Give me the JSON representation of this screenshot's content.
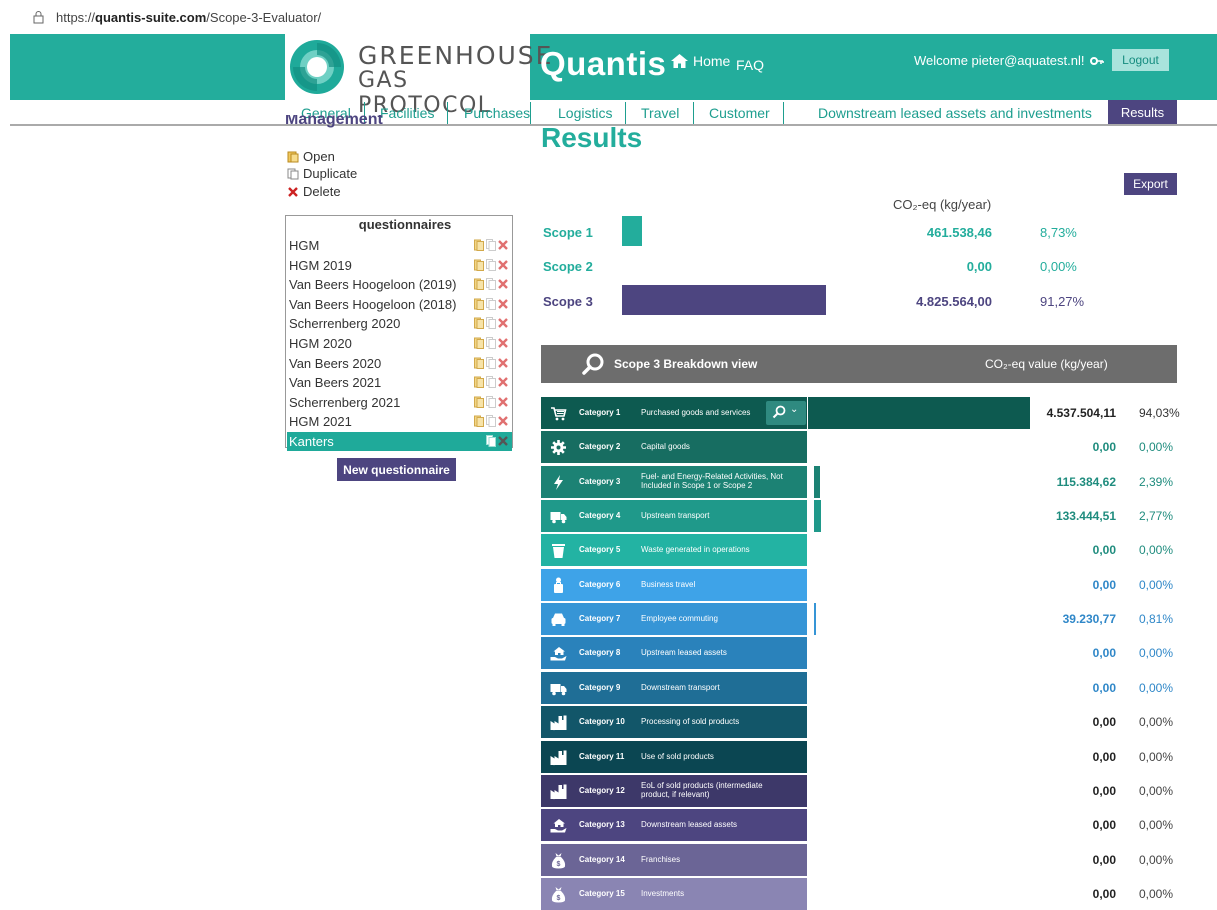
{
  "browser": {
    "url_prefix": "https://",
    "url_domain": "quantis-suite.com",
    "url_path": "/Scope-3-Evaluator/"
  },
  "header": {
    "logo_line1": "GREENHOUSE",
    "logo_line2": "GAS PROTOCOL",
    "brand": "Quantis",
    "home": "Home",
    "faq": "FAQ",
    "welcome": "Welcome pieter@aquatest.nl!",
    "logout": "Logout",
    "color": "#23ad9c"
  },
  "tabs": [
    "General",
    "Facilities",
    "Purchases",
    "Logistics",
    "Travel",
    "Customer",
    "Downstream leased assets and investments"
  ],
  "active_tab": "Results",
  "management": {
    "title": "Management",
    "open": "Open",
    "duplicate": "Duplicate",
    "delete": "Delete",
    "list_title": "questionnaires",
    "items": [
      "HGM",
      "HGM 2019",
      "Van Beers Hoogeloon (2019)",
      "Van Beers Hoogeloon (2018)",
      "Scherrenberg 2020",
      "HGM 2020",
      "Van Beers 2020",
      "Van Beers 2021",
      "Scherrenberg 2021",
      "HGM 2021",
      "Kanters"
    ],
    "selected": "Kanters",
    "new_button": "New questionnaire"
  },
  "results": {
    "title": "Results",
    "export": "Export",
    "unit_header": "CO₂-eq (kg/year)",
    "scopes": [
      {
        "label": "Scope 1",
        "value": "461.538,46",
        "pct": "8,73%",
        "share": 0.0873,
        "color": "#23ad9c"
      },
      {
        "label": "Scope 2",
        "value": "0,00",
        "pct": "0,00%",
        "share": 0,
        "color": "#23ad9c"
      },
      {
        "label": "Scope 3",
        "value": "4.825.564,00",
        "pct": "91,27%",
        "share": 0.9127,
        "color": "#4d4580"
      }
    ],
    "breakdown_title": "Scope 3 Breakdown view",
    "breakdown_unit": "CO₂-eq value (kg/year)",
    "categories": [
      {
        "num": "Category  1",
        "desc": "Purchased goods and services",
        "value": "4.537.504,11",
        "pct": "94,03%",
        "share": 0.9403,
        "color": "#0d5a50",
        "icon": "cart-icon"
      },
      {
        "num": "Category  2",
        "desc": "Capital goods",
        "value": "0,00",
        "pct": "0,00%",
        "share": 0,
        "color": "#176d61",
        "icon": "gear-icon"
      },
      {
        "num": "Category  3",
        "desc": "Fuel- and Energy-Related Activities, Not Included in Scope 1 or Scope 2",
        "value": "115.384,62",
        "pct": "2,39%",
        "share": 0.0239,
        "color": "#1c8274",
        "icon": "lightning-icon"
      },
      {
        "num": "Category  4",
        "desc": "Upstream transport",
        "value": "133.444,51",
        "pct": "2,77%",
        "share": 0.0277,
        "color": "#1f998a",
        "icon": "truck-icon"
      },
      {
        "num": "Category  5",
        "desc": "Waste generated in operations",
        "value": "0,00",
        "pct": "0,00%",
        "share": 0,
        "color": "#23b3a3",
        "icon": "trash-icon"
      },
      {
        "num": "Category  6",
        "desc": "Business travel",
        "value": "0,00",
        "pct": "0,00%",
        "share": 0,
        "color": "#3ea3e8",
        "icon": "traveler-icon"
      },
      {
        "num": "Category  7",
        "desc": "Employee commuting",
        "value": "39.230,77",
        "pct": "0,81%",
        "share": 0.0081,
        "color": "#3695d6",
        "icon": "car-icon"
      },
      {
        "num": "Category  8",
        "desc": "Upstream leased assets",
        "value": "0,00",
        "pct": "0,00%",
        "share": 0,
        "color": "#2a82bb",
        "icon": "hand-house-icon"
      },
      {
        "num": "Category  9",
        "desc": "Downstream transport",
        "value": "0,00",
        "pct": "0,00%",
        "share": 0,
        "color": "#1f6e96",
        "icon": "truck-icon"
      },
      {
        "num": "Category 10",
        "desc": "Processing of sold products",
        "value": "0,00",
        "pct": "0,00%",
        "share": 0,
        "color": "#125669",
        "icon": "factory-icon"
      },
      {
        "num": "Category 11",
        "desc": "Use of sold products",
        "value": "0,00",
        "pct": "0,00%",
        "share": 0,
        "color": "#0b4652",
        "icon": "factory-icon"
      },
      {
        "num": "Category 12",
        "desc": "EoL of sold products (intermediate product, if relevant)",
        "value": "0,00",
        "pct": "0,00%",
        "share": 0,
        "color": "#3d3869",
        "icon": "factory-icon"
      },
      {
        "num": "Category 13",
        "desc": "Downstream leased assets",
        "value": "0,00",
        "pct": "0,00%",
        "share": 0,
        "color": "#4d4580",
        "icon": "hand-house-icon"
      },
      {
        "num": "Category 14",
        "desc": "Franchises",
        "value": "0,00",
        "pct": "0,00%",
        "share": 0,
        "color": "#6b6596",
        "icon": "moneybag-icon"
      },
      {
        "num": "Category 15",
        "desc": "Investments",
        "value": "0,00",
        "pct": "0,00%",
        "share": 0,
        "color": "#8a85b3",
        "icon": "moneybag-icon"
      }
    ]
  }
}
